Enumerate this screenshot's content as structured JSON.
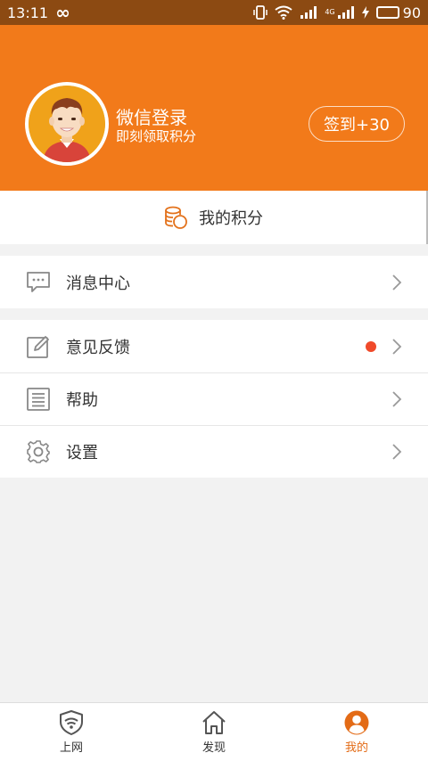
{
  "status_bar": {
    "time": "13:11",
    "battery_level": "90",
    "network_badge": "4G"
  },
  "header": {
    "login_title": "微信登录",
    "login_subtitle": "即刻领取积分",
    "signin_label": "签到+30",
    "colors": {
      "background": "#f27a1a",
      "avatar_bg": "#f0a21a"
    }
  },
  "points": {
    "label": "我的积分"
  },
  "menu": {
    "messages": {
      "label": "消息中心"
    },
    "feedback": {
      "label": "意见反馈",
      "has_badge": true
    },
    "help": {
      "label": "帮助"
    },
    "settings": {
      "label": "设置"
    }
  },
  "tabs": [
    {
      "label": "上网",
      "icon": "wifi-shield-icon",
      "active": false
    },
    {
      "label": "发现",
      "icon": "home-icon",
      "active": false
    },
    {
      "label": "我的",
      "icon": "profile-icon",
      "active": true
    }
  ]
}
